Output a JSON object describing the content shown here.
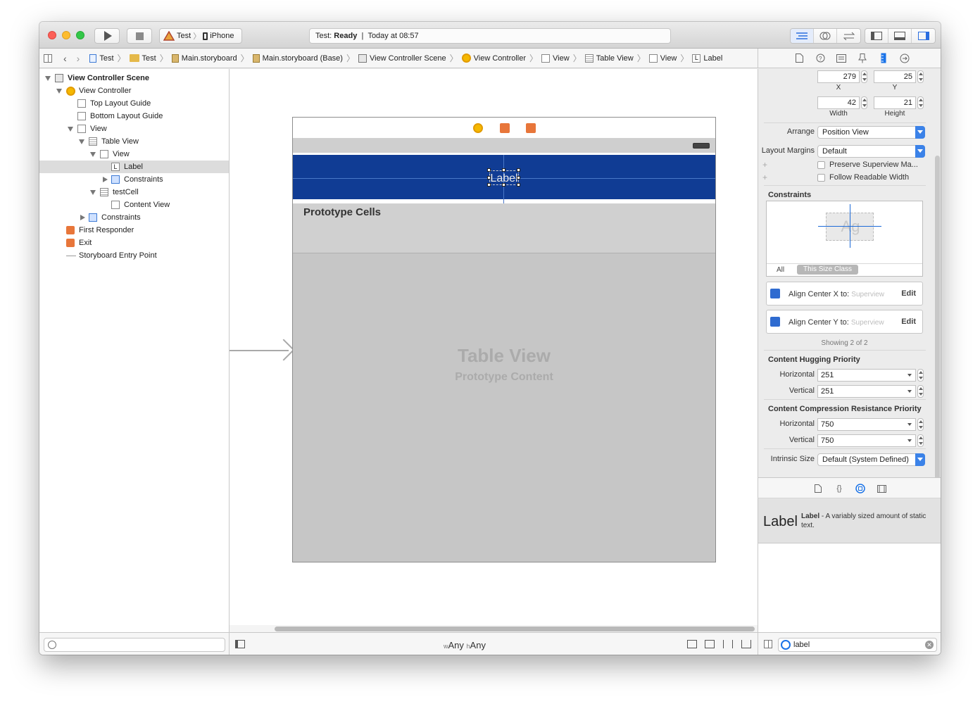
{
  "toolbar": {
    "scheme_target": "Test",
    "scheme_device": "iPhone",
    "activity_project": "Test:",
    "activity_status": "Ready",
    "activity_separator": "|",
    "activity_time": "Today at 08:57"
  },
  "breadcrumb": [
    {
      "label": "Test",
      "icon": "project-file-icon"
    },
    {
      "label": "Test",
      "icon": "folder-icon"
    },
    {
      "label": "Main.storyboard",
      "icon": "storyboard-icon"
    },
    {
      "label": "Main.storyboard (Base)",
      "icon": "storyboard-icon"
    },
    {
      "label": "View Controller Scene",
      "icon": "scene-icon"
    },
    {
      "label": "View Controller",
      "icon": "view-controller-icon"
    },
    {
      "label": "View",
      "icon": "view-icon"
    },
    {
      "label": "Table View",
      "icon": "table-view-icon"
    },
    {
      "label": "View",
      "icon": "view-icon"
    },
    {
      "label": "Label",
      "icon": "label-icon"
    }
  ],
  "outline": [
    {
      "label": "View Controller Scene",
      "depth": 0,
      "disclosure": "open",
      "icon": "scene",
      "bold": true
    },
    {
      "label": "View Controller",
      "depth": 1,
      "disclosure": "open",
      "icon": "vc"
    },
    {
      "label": "Top Layout Guide",
      "depth": 2,
      "disclosure": "none",
      "icon": "view"
    },
    {
      "label": "Bottom Layout Guide",
      "depth": 2,
      "disclosure": "none",
      "icon": "view"
    },
    {
      "label": "View",
      "depth": 2,
      "disclosure": "open",
      "icon": "view"
    },
    {
      "label": "Table View",
      "depth": 3,
      "disclosure": "open",
      "icon": "table"
    },
    {
      "label": "View",
      "depth": 4,
      "disclosure": "open",
      "icon": "view"
    },
    {
      "label": "Label",
      "depth": 5,
      "disclosure": "none",
      "icon": "label",
      "selected": true
    },
    {
      "label": "Constraints",
      "depth": 5,
      "disclosure": "closed",
      "icon": "cons"
    },
    {
      "label": "testCell",
      "depth": 4,
      "disclosure": "open",
      "icon": "table"
    },
    {
      "label": "Content View",
      "depth": 5,
      "disclosure": "none",
      "icon": "view"
    },
    {
      "label": "Constraints",
      "depth": 3,
      "disclosure": "closed",
      "icon": "cons"
    },
    {
      "label": "First Responder",
      "depth": 1,
      "disclosure": "none",
      "icon": "resp"
    },
    {
      "label": "Exit",
      "depth": 1,
      "disclosure": "none",
      "icon": "exit"
    },
    {
      "label": "Storyboard Entry Point",
      "depth": 1,
      "disclosure": "none",
      "icon": "arrow"
    }
  ],
  "canvas": {
    "selected_label_text": "Label",
    "prototype_cells_title": "Prototype Cells",
    "table_view_title": "Table View",
    "table_view_subtitle": "Prototype Content",
    "size_class_w_prefix": "w",
    "size_class_w": "Any",
    "size_class_h_prefix": "h",
    "size_class_h": "Any"
  },
  "inspector": {
    "x_value": "279",
    "y_value": "25",
    "x_caption": "X",
    "y_caption": "Y",
    "width_value": "42",
    "height_value": "21",
    "width_caption": "Width",
    "height_caption": "Height",
    "arrange_label": "Arrange",
    "arrange_value": "Position View",
    "layout_margins_label": "Layout Margins",
    "layout_margins_value": "Default",
    "preserve_superview": "Preserve Superview Ma...",
    "follow_readable": "Follow Readable Width",
    "constraints_title": "Constraints",
    "constraints_preview_text": "Ag",
    "tab_all": "All",
    "tab_size_class": "This Size Class",
    "constraint_items": [
      {
        "text": "Align Center X to:",
        "target": "Superview",
        "edit": "Edit"
      },
      {
        "text": "Align Center Y to:",
        "target": "Superview",
        "edit": "Edit"
      }
    ],
    "showing": "Showing 2 of 2",
    "hugging_title": "Content Hugging Priority",
    "horizontal_label": "Horizontal",
    "vertical_label": "Vertical",
    "hugging_h": "251",
    "hugging_v": "251",
    "compression_title": "Content Compression Resistance Priority",
    "compression_h": "750",
    "compression_v": "750",
    "intrinsic_label": "Intrinsic Size",
    "intrinsic_value": "Default (System Defined)"
  },
  "library": {
    "item_big": "Label",
    "item_title": "Label",
    "item_desc": " - A variably sized amount of static text.",
    "filter_value": "label"
  }
}
